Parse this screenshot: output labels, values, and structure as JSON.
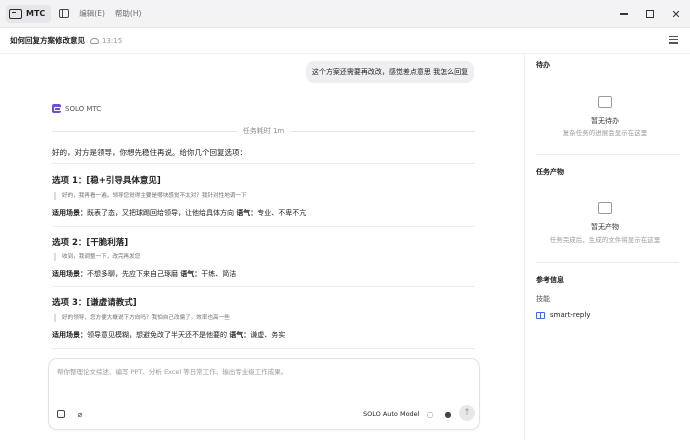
{
  "titlebar": {
    "app_name": "MTC",
    "menu": [
      "编辑(E)",
      "帮助(H)"
    ]
  },
  "header": {
    "title": "如何回复方案修改意见",
    "time": "13:15"
  },
  "chat": {
    "user_message": "这个方案还需要再改改，感觉差点意思 我怎么回复",
    "agent_name": "SOLO MTC",
    "task_time": "任务耗时 1m",
    "intro": "好的，对方是领导，你想先稳住再说。给你几个回复选项：",
    "options": [
      {
        "title": "选项 1：[稳+引导具体意见]",
        "quote": "好的，我再看一遍。领导您觉得主要是哪块感觉不太对？我针对性地调一下",
        "scene_label": "适用场景：",
        "scene": "既表了态，又把球踢回给领导，让他给具体方向",
        "tone_label": "语气：",
        "tone": "专业、不卑不亢"
      },
      {
        "title": "选项 2：[干脆利落]",
        "quote": "收到，我调整一下，改完再发您",
        "scene_label": "适用场景：",
        "scene": "不想多聊，先应下来自己琢磨",
        "tone_label": "语气：",
        "tone": "干练、简洁"
      },
      {
        "title": "选项 3：[谦虚请教式]",
        "quote": "好的领导，您方便大概说下方向吗？我怕自己改偏了，效率也高一些",
        "scene_label": "适用场景：",
        "scene": "领导意见模糊，想避免改了半天还不是他要的",
        "tone_label": "语气：",
        "tone": "谦虚、务实"
      }
    ]
  },
  "composer": {
    "placeholder": "帮你整理论文综述、编写 PPT、分析 Excel 等日常工作，输出专业级工作成果。",
    "model": "SOLO Auto Model"
  },
  "right_panel": {
    "todo": {
      "title": "待办",
      "empty_title": "暂无待办",
      "empty_desc": "复杂任务的进展会显示在这里"
    },
    "artifacts": {
      "title": "任务产物",
      "empty_title": "暂无产物",
      "empty_desc": "任务完成后，生成的文件将显示在这里"
    },
    "reference": {
      "title": "参考信息",
      "skills_label": "技能",
      "skill": "smart-reply"
    }
  }
}
